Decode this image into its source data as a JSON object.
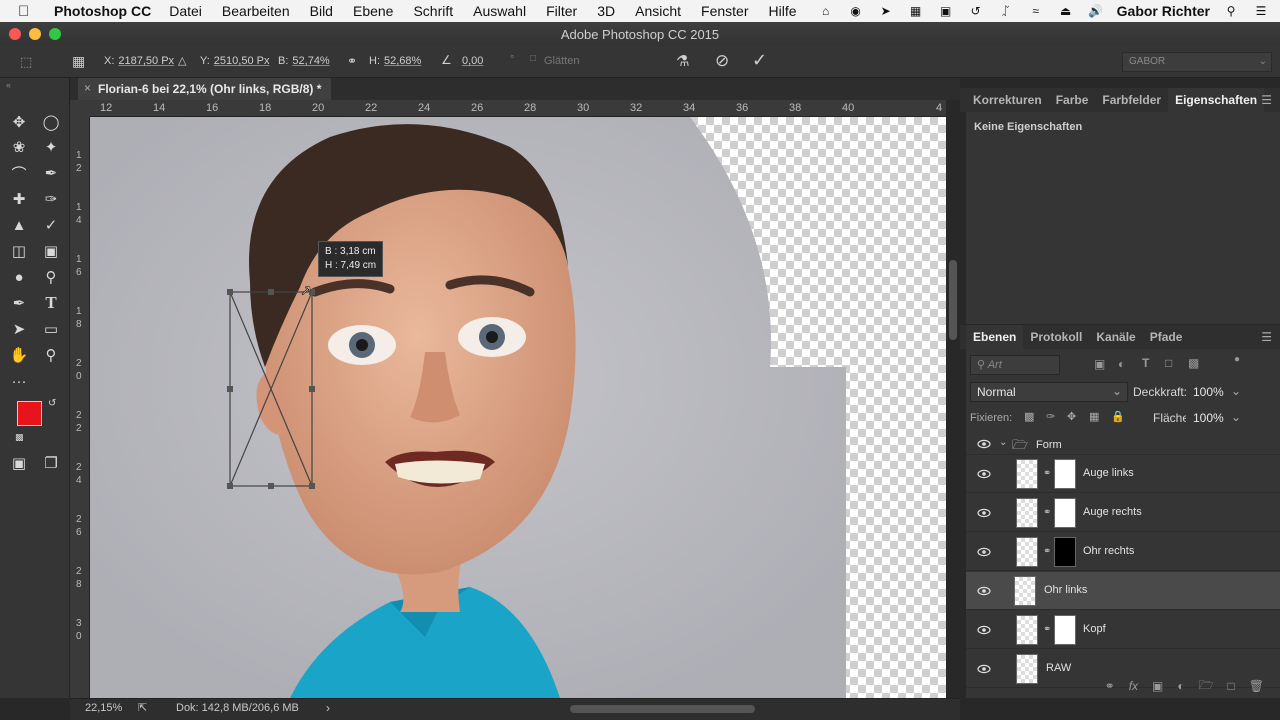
{
  "menubar": {
    "app_name": "Photoshop CC",
    "menus": [
      "Datei",
      "Bearbeiten",
      "Bild",
      "Ebene",
      "Schrift",
      "Auswahl",
      "Filter",
      "3D",
      "Ansicht",
      "Fenster",
      "Hilfe"
    ],
    "user": "Gabor Richter"
  },
  "window": {
    "title": "Adobe Photoshop CC 2015"
  },
  "options": {
    "x_label": "X:",
    "x_value": "2187,50 Px",
    "y_label": "Y:",
    "y_value": "2510,50 Px",
    "w_label": "B:",
    "w_value": "52,74%",
    "h_label": "H:",
    "h_value": "52,68%",
    "angle_value": "0,00",
    "degree": "°",
    "smooth_label": "Glätten",
    "workspace": "GABOR"
  },
  "document": {
    "tab_title": "Florian-6 bei 22,1% (Ohr links, RGB/8) *",
    "ruler_h": [
      "12",
      "14",
      "16",
      "18",
      "20",
      "22",
      "24",
      "26",
      "28",
      "30",
      "32",
      "34",
      "36",
      "38",
      "40",
      "4"
    ],
    "ruler_v": [
      "1 2",
      "1 4",
      "1 6",
      "1 8",
      "2 0",
      "2 2",
      "2 4",
      "2 6",
      "2 8",
      "3 0"
    ],
    "transform_w": "B : 3,18 cm",
    "transform_h": "H : 7,49 cm"
  },
  "status": {
    "zoom": "22,15%",
    "doc_info": "Dok: 142,8 MB/206,6 MB",
    "arrow": "›"
  },
  "properties_panel": {
    "tabs": [
      "Korrekturen",
      "Farbe",
      "Farbfelder",
      "Eigenschaften"
    ],
    "active_tab": 3,
    "empty_text": "Keine Eigenschaften"
  },
  "layers_panel": {
    "tabs": [
      "Ebenen",
      "Protokoll",
      "Kanäle",
      "Pfade"
    ],
    "filter_placeholder": "Art",
    "blend_mode": "Normal",
    "opacity_label": "Deckkraft:",
    "opacity_value": "100%",
    "lock_label": "Fixieren:",
    "fill_label": "Fläche:",
    "fill_value": "100%",
    "group_name": "Form",
    "layers": [
      {
        "name": "Auge links",
        "mask": "white"
      },
      {
        "name": "Auge rechts",
        "mask": "white"
      },
      {
        "name": "Ohr rechts",
        "mask": "black"
      },
      {
        "name": "Ohr links",
        "mask": "none"
      },
      {
        "name": "Kopf",
        "mask": "white"
      },
      {
        "name": "RAW",
        "mask": "none"
      }
    ],
    "active_layer": 3
  },
  "colors": {
    "foreground": "#e8141c",
    "background": "#ffffff",
    "skin": "#e3a98c",
    "shirt": "#1aa5c8",
    "bg_gray": "#b9b9bf"
  }
}
